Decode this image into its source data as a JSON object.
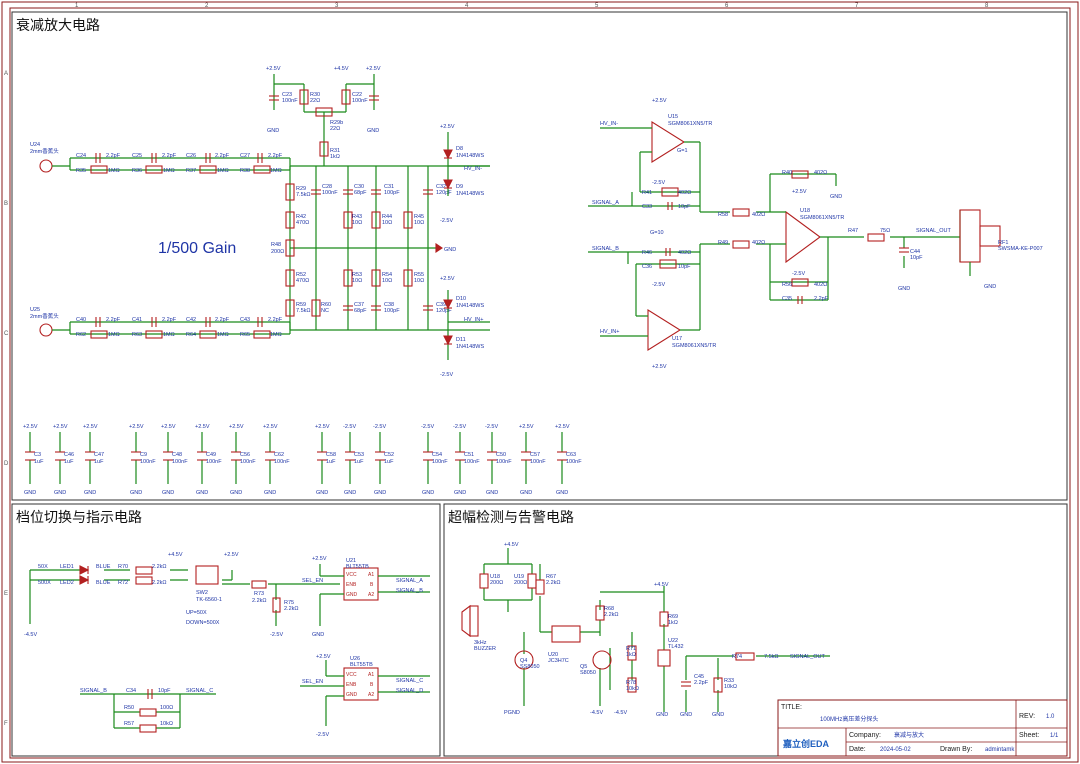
{
  "sections": {
    "attenuator": "衰减放大电路",
    "switch": "档位切换与指示电路",
    "overrange": "超幅检测与告警电路"
  },
  "gain_label": "1/500 Gain",
  "amp": {
    "g1": "G=1",
    "g10": "G=10",
    "u15_ref": "U15",
    "u15_part": "SGM8061XN5/TR",
    "u17_ref": "U17",
    "u17_part": "SGM8061XN5/TR",
    "u18_ref": "U18",
    "u18_part": "SGM8061XN5/TR"
  },
  "inputs": {
    "u24": "U24",
    "u24_name": "2mm香蕉头",
    "u25": "U25",
    "u25_name": "2mm香蕉头"
  },
  "top_chain_caps": [
    "C24",
    "2.2pF",
    "C25",
    "2.2pF",
    "C26",
    "2.2pF",
    "C27",
    "2.2pF"
  ],
  "top_chain_res": [
    "R35",
    "1MΩ",
    "R36",
    "1MΩ",
    "R37",
    "1MΩ",
    "R38",
    "1MΩ"
  ],
  "bot_chain_caps": [
    "C40",
    "2.2pF",
    "C41",
    "2.2pF",
    "C42",
    "2.2pF",
    "C43",
    "2.2pF"
  ],
  "bot_chain_res": [
    "R62",
    "1MΩ",
    "R63",
    "1MΩ",
    "R64",
    "1MΩ",
    "R65",
    "1MΩ"
  ],
  "divider_labels": [
    "R29",
    "7.5kΩ",
    "R42",
    "470Ω",
    "R48",
    "200Ω",
    "R52",
    "470Ω",
    "R59",
    "7.5kΩ",
    "R60",
    "NC",
    "C28",
    "100nF",
    "C30",
    "68pF",
    "C37",
    "68pF",
    "R43",
    "10Ω",
    "R53",
    "10Ω",
    "R44",
    "10Ω",
    "R54",
    "10Ω",
    "R45",
    "10Ω",
    "R55",
    "10Ω",
    "C31",
    "100pF",
    "C38",
    "100pF",
    "C32",
    "120pF",
    "C39",
    "120pF",
    "R34",
    "330kΩ",
    "R31",
    "1kΩ",
    "R29b",
    "22Ω",
    "R30",
    "22Ω",
    "C22",
    "100nF",
    "C23",
    "100nF"
  ],
  "diodes": [
    "D8",
    "1N4148WS",
    "D9",
    "1N4148WS",
    "D10",
    "1N4148WS",
    "D11",
    "1N4148WS"
  ],
  "nets": {
    "hv_in_minus": "HV_IN-",
    "hv_in_plus": "HV_IN+",
    "signal_a": "SIGNAL_A",
    "signal_b": "SIGNAL_B",
    "signal_c": "SIGNAL_C",
    "signal_d": "SIGNAL_D",
    "signal_out": "SIGNAL_OUT",
    "sel_en": "SEL_EN",
    "p25": "+2.5V",
    "m25": "-2.5V",
    "p45": "+4.5V",
    "m45": "-4.5V",
    "gnd": "GND",
    "pgnd": "PGND"
  },
  "amp_parts": [
    "R41",
    "402Ω",
    "C33",
    "10pF",
    "R46",
    "402Ω",
    "C36",
    "10pF",
    "R58",
    "402Ω",
    "R49",
    "402Ω",
    "R40",
    "402Ω",
    "R56",
    "402Ω",
    "C35",
    "2.2pF",
    "R47",
    "75Ω",
    "C44",
    "10pF",
    "RF1",
    "SWSMA-KE-P007"
  ],
  "decoupling": [
    {
      "ref": "C3",
      "val": "1uF"
    },
    {
      "ref": "C46",
      "val": "1uF"
    },
    {
      "ref": "C47",
      "val": "1uF"
    },
    {
      "ref": "C9",
      "val": "100nF"
    },
    {
      "ref": "C48",
      "val": "100nF"
    },
    {
      "ref": "C49",
      "val": "100nF"
    },
    {
      "ref": "C56",
      "val": "100nF"
    },
    {
      "ref": "C62",
      "val": "100nF"
    },
    {
      "ref": "C58",
      "val": "1uF"
    },
    {
      "ref": "C53",
      "val": "1uF"
    },
    {
      "ref": "C52",
      "val": "1uF"
    },
    {
      "ref": "C54",
      "val": "100nF"
    },
    {
      "ref": "C51",
      "val": "100nF"
    },
    {
      "ref": "C50",
      "val": "100nF"
    },
    {
      "ref": "C57",
      "val": "100nF"
    },
    {
      "ref": "C63",
      "val": "100nF"
    }
  ],
  "switch_circuit": {
    "x50": "50X",
    "x500": "500X",
    "led1": "LED1",
    "led2": "LED2",
    "blue": "BLUE",
    "r70": "R70",
    "r72": "R72",
    "r2k2": "2.2kΩ",
    "sw2": "SW2",
    "sw2_part": "TK-6560-1",
    "r73": "R73",
    "r75": "R75",
    "up": "UP=50X",
    "down": "DOWN=500X",
    "u21": "U21",
    "u21_part": "BLT55TB",
    "u26": "U26",
    "u26_part": "BLT55TB",
    "vcc": "VCC",
    "enb": "ENB",
    "a1": "A1",
    "a2": "A2",
    "b": "B",
    "c34": "C34",
    "c34v": "10pF",
    "r50": "R50",
    "r50v": "100Ω",
    "r57": "R57",
    "r57v": "10kΩ"
  },
  "alarm": {
    "u18b": "U18",
    "u18bv": "200Ω",
    "u19": "U19",
    "u19v": "200Ω",
    "r67": "R67",
    "r67v": "2.2kΩ",
    "buzzer": "3kHz",
    "buzzer_name": "BUZZER",
    "q4": "Q4",
    "q4p": "SS8050",
    "u20": "U20",
    "u20p": "JC3H7C",
    "q5": "Q5",
    "q5p": "S8050",
    "r68": "R68",
    "r68v": "2.2kΩ",
    "r71": "R71",
    "r71v": "1kΩ",
    "r78": "R78",
    "r78v": "10kΩ",
    "r69": "R69",
    "r69v": "1kΩ",
    "u22": "U22",
    "u22p": "TL432",
    "c45": "C45",
    "c45v": "2.2pF",
    "r33": "R33",
    "r33v": "10kΩ",
    "r74": "R74",
    "r74v": "7.5kΩ"
  },
  "titleblock": {
    "title_label": "TITLE:",
    "title_value": "100MHz高压差分探头",
    "rev_label": "REV:",
    "rev_value": "1.0",
    "company_label": "Company:",
    "company_value": "衰减与放大",
    "sheet_label": "Sheet:",
    "sheet_value": "1/1",
    "date_label": "Date:",
    "date_value": "2024-05-02",
    "drawn_label": "Drawn By:",
    "drawn_value": "admintamk",
    "logo": "嘉立创EDA"
  },
  "ruler": {
    "cols": [
      "1",
      "2",
      "3",
      "4",
      "5",
      "6",
      "7",
      "8"
    ],
    "rows": [
      "A",
      "B",
      "C",
      "D",
      "E",
      "F"
    ]
  },
  "colors": {
    "wire": "#1a8a1a",
    "part": "#b32020",
    "label": "#1f35a6",
    "frame": "#8a1a1a"
  }
}
